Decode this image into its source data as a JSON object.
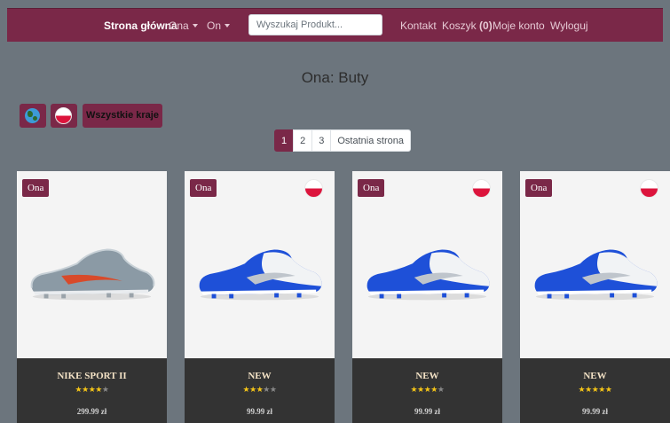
{
  "nav": {
    "home": "Strona główna",
    "ona": "Ona",
    "on": "On",
    "search_placeholder": "Wyszukaj Produkt...",
    "contact": "Kontakt",
    "cart_label": "Koszyk",
    "cart_count": "(0)",
    "account": "Moje konto",
    "logout": "Wyloguj"
  },
  "page_title": "Ona: Buty",
  "filters": {
    "all_countries": "Wszystkie kraje"
  },
  "pagination": {
    "pages": [
      "1",
      "2",
      "3"
    ],
    "active_page": "1",
    "last": "Ostatnia strona"
  },
  "products": [
    {
      "badge": "Ona",
      "name": "NIKE SPORT II",
      "rating": 4,
      "price": "299.99 zł",
      "has_flag": false,
      "shoe_color": "#8b9aa5"
    },
    {
      "badge": "Ona",
      "name": "NEW",
      "rating": 3,
      "price": "99.99 zł",
      "has_flag": true,
      "shoe_color": "#1e50d8"
    },
    {
      "badge": "Ona",
      "name": "NEW",
      "rating": 4,
      "price": "99.99 zł",
      "has_flag": true,
      "shoe_color": "#1e50d8"
    },
    {
      "badge": "Ona",
      "name": "NEW",
      "rating": 5,
      "price": "99.99 zł",
      "has_flag": true,
      "shoe_color": "#1e50d8"
    }
  ],
  "colors": {
    "brand": "#7a2848",
    "background": "#6c757d",
    "card_footer": "#333333",
    "star": "#f5c518"
  },
  "icons": {
    "globe": "globe-icon",
    "poland_flag": "poland-flag-icon",
    "dropdown": "caret-down-icon"
  }
}
